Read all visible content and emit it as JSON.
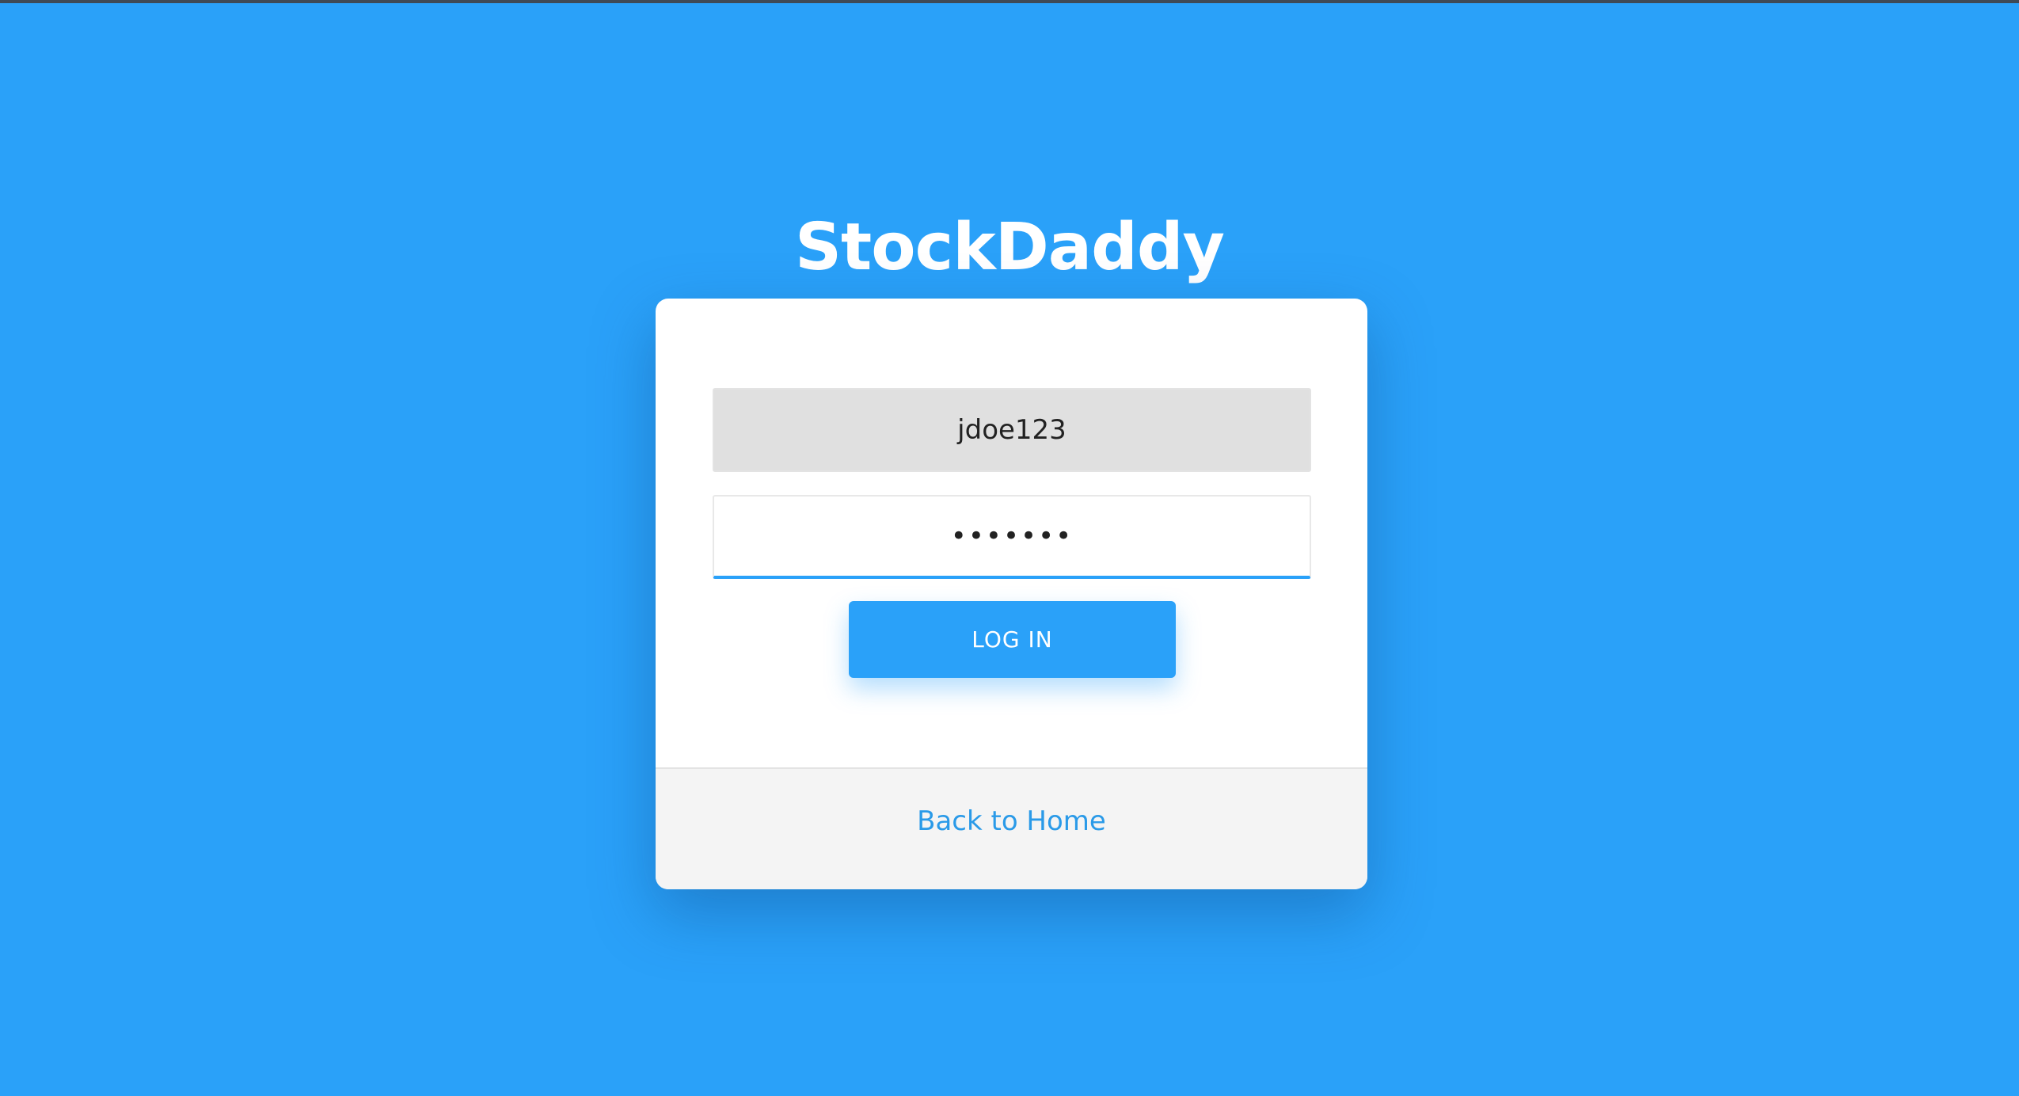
{
  "app": {
    "brand": "StockDaddy"
  },
  "login_form": {
    "username_value": "jdoe123",
    "password_value": "•••••••",
    "login_label": "LOG IN"
  },
  "footer": {
    "back_link_label": "Back to Home"
  },
  "colors": {
    "background": "#2aa1f9",
    "accent": "#2aa1f9",
    "card": "#ffffff",
    "footer": "#f4f4f4",
    "username_field": "#e0e0e0"
  }
}
